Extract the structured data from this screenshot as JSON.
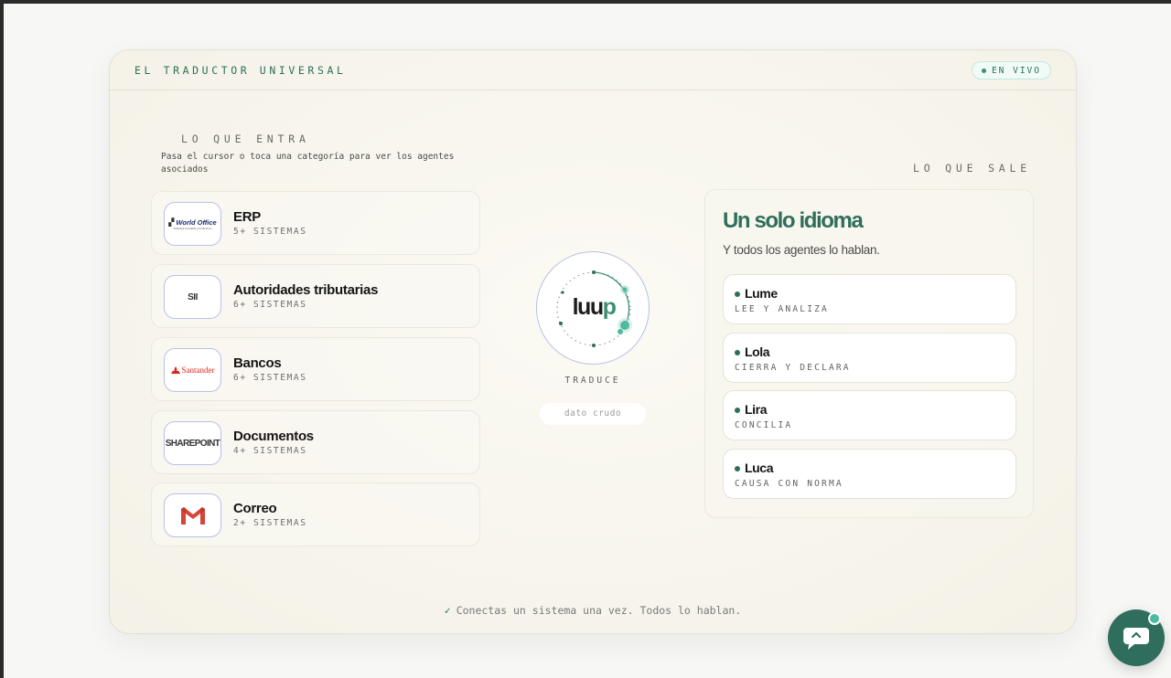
{
  "header": {
    "title": "EL TRADUCTOR UNIVERSAL",
    "live_label": "EN VIVO"
  },
  "input": {
    "title": "LO QUE ENTRA",
    "subtitle": "Pasa el cursor o toca una categoría para ver los agentes asociados",
    "categories": [
      {
        "name": "ERP",
        "count": "5+ SISTEMAS",
        "logo_text": "World Office",
        "logo_subtext": "Software Contable y Financiero",
        "icon": "world-office-logo"
      },
      {
        "name": "Autoridades tributarias",
        "count": "6+ SISTEMAS",
        "logo_text": "SII",
        "icon": "sii-logo"
      },
      {
        "name": "Bancos",
        "count": "6+ SISTEMAS",
        "logo_text": "Santander",
        "icon": "santander-logo"
      },
      {
        "name": "Documentos",
        "count": "4+ SISTEMAS",
        "logo_text": "SHAREPOINT",
        "icon": "sharepoint-logo"
      },
      {
        "name": "Correo",
        "count": "2+ SISTEMAS",
        "icon": "gmail-logo"
      }
    ]
  },
  "center": {
    "logo_main": "luu",
    "logo_accent": "p",
    "label": "TRADUCE",
    "raw_label": "dato crudo"
  },
  "output": {
    "title": "LO QUE SALE",
    "heading": "Un solo idioma",
    "subheading": "Y todos los agentes lo hablan.",
    "agents": [
      {
        "name": "Lume",
        "role": "LEE Y ANALIZA"
      },
      {
        "name": "Lola",
        "role": "CIERRA Y DECLARA"
      },
      {
        "name": "Lira",
        "role": "CONCILIA"
      },
      {
        "name": "Luca",
        "role": "CAUSA CON NORMA"
      }
    ]
  },
  "footer": {
    "icon": "check-icon",
    "text": "Conectas un sistema una vez. Todos lo hablan."
  },
  "chat": {
    "icon": "chat-bubble-icon"
  },
  "colors": {
    "accent": "#2f6e5c",
    "accent_light": "#4fb9a2",
    "ring": "#b6c0e6",
    "background": "#f7f5ec"
  }
}
